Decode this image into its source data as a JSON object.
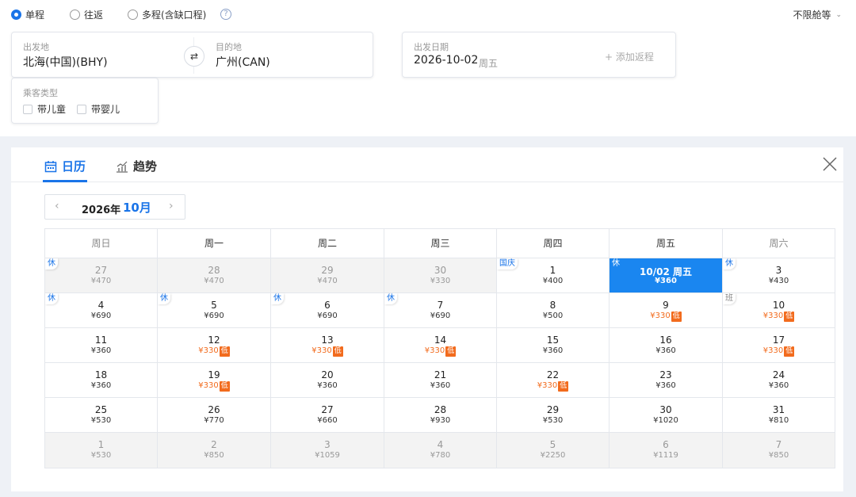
{
  "trip_types": [
    {
      "label": "单程",
      "selected": true
    },
    {
      "label": "往返",
      "selected": false
    },
    {
      "label": "多程(含缺口程)",
      "selected": false
    }
  ],
  "help_icon": "?",
  "cabin": {
    "label": "不限舱等"
  },
  "route": {
    "from_label": "出发地",
    "from_value": "北海(中国)(BHY)",
    "to_label": "目的地",
    "to_value": "广州(CAN)"
  },
  "date": {
    "label": "出发日期",
    "value": "2026-10-02",
    "weekday": "周五",
    "add_return": "+ 添加返程"
  },
  "passenger": {
    "label": "乘客类型",
    "child": "带儿童",
    "infant": "带婴儿"
  },
  "tabs": {
    "calendar": "日历",
    "trend": "趋势"
  },
  "month_nav": {
    "year": "2026年",
    "month": "10月"
  },
  "weekdays": [
    "周日",
    "周一",
    "周二",
    "周三",
    "周四",
    "周五",
    "周六"
  ],
  "colors": {
    "accent": "#1a74e8",
    "selected": "#1a86f0",
    "low": "#f26b1d"
  },
  "low_tag": "低",
  "days": [
    {
      "day": "27",
      "price": "¥470",
      "dim": true,
      "badge": "休"
    },
    {
      "day": "28",
      "price": "¥470",
      "dim": true
    },
    {
      "day": "29",
      "price": "¥470",
      "dim": true
    },
    {
      "day": "30",
      "price": "¥330",
      "dim": true
    },
    {
      "day": "1",
      "price": "¥400",
      "badge": "国庆"
    },
    {
      "day": "10/02 周五",
      "price": "¥360",
      "selected": true,
      "badge": "休"
    },
    {
      "day": "3",
      "price": "¥430",
      "badge": "休"
    },
    {
      "day": "4",
      "price": "¥690",
      "badge": "休"
    },
    {
      "day": "5",
      "price": "¥690",
      "badge": "休"
    },
    {
      "day": "6",
      "price": "¥690",
      "badge": "休"
    },
    {
      "day": "7",
      "price": "¥690",
      "badge": "休"
    },
    {
      "day": "8",
      "price": "¥500"
    },
    {
      "day": "9",
      "price": "¥330",
      "low": true
    },
    {
      "day": "10",
      "price": "¥330",
      "low": true,
      "badge": "班"
    },
    {
      "day": "11",
      "price": "¥360"
    },
    {
      "day": "12",
      "price": "¥330",
      "low": true
    },
    {
      "day": "13",
      "price": "¥330",
      "low": true
    },
    {
      "day": "14",
      "price": "¥330",
      "low": true
    },
    {
      "day": "15",
      "price": "¥360"
    },
    {
      "day": "16",
      "price": "¥360"
    },
    {
      "day": "17",
      "price": "¥330",
      "low": true
    },
    {
      "day": "18",
      "price": "¥360"
    },
    {
      "day": "19",
      "price": "¥330",
      "low": true
    },
    {
      "day": "20",
      "price": "¥360"
    },
    {
      "day": "21",
      "price": "¥360"
    },
    {
      "day": "22",
      "price": "¥330",
      "low": true
    },
    {
      "day": "23",
      "price": "¥360"
    },
    {
      "day": "24",
      "price": "¥360"
    },
    {
      "day": "25",
      "price": "¥530"
    },
    {
      "day": "26",
      "price": "¥770"
    },
    {
      "day": "27",
      "price": "¥660"
    },
    {
      "day": "28",
      "price": "¥930"
    },
    {
      "day": "29",
      "price": "¥530"
    },
    {
      "day": "30",
      "price": "¥1020"
    },
    {
      "day": "31",
      "price": "¥810"
    },
    {
      "day": "1",
      "price": "¥530",
      "dim": true
    },
    {
      "day": "2",
      "price": "¥850",
      "dim": true
    },
    {
      "day": "3",
      "price": "¥1059",
      "dim": true
    },
    {
      "day": "4",
      "price": "¥780",
      "dim": true
    },
    {
      "day": "5",
      "price": "¥2250",
      "dim": true
    },
    {
      "day": "6",
      "price": "¥1119",
      "dim": true
    },
    {
      "day": "7",
      "price": "¥850",
      "dim": true
    }
  ]
}
